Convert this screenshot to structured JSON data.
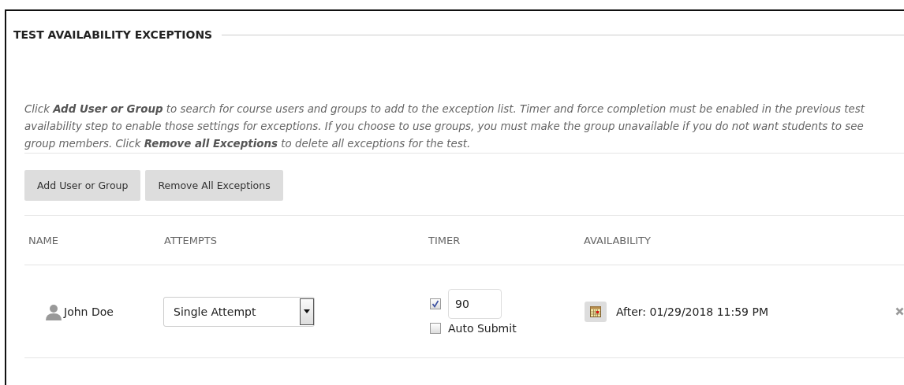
{
  "section": {
    "title": "TEST AVAILABILITY EXCEPTIONS"
  },
  "instructions": "Click **Add User or Group** to search for course users and groups to add to the exception list. Timer and force completion must be enabled in the previous test availability step to enable those settings for exceptions. If you choose to use groups, you must make the group unavailable if you do not want students to see group members. Click **Remove all Exceptions** to delete all exceptions for the test.",
  "buttons": [
    "Add User or Group",
    "Remove All Exceptions"
  ],
  "table": {
    "columns": [
      "NAME",
      "ATTEMPTS",
      "TIMER",
      "AVAILABILITY"
    ],
    "rows": [
      {
        "name": "John Doe",
        "attempts": "Single Attempt",
        "timer_enabled": true,
        "timer_value": "90",
        "auto_submit_label": "Auto Submit",
        "auto_submit": false,
        "availability": "After: 01/29/2018 11:59 PM"
      }
    ]
  }
}
